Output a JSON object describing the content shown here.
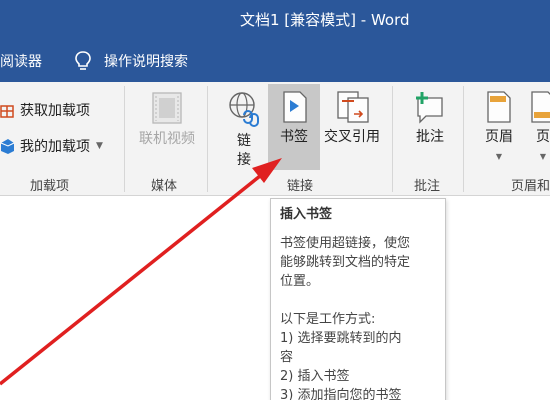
{
  "window": {
    "title": "文档1 [兼容模式]  -  Word"
  },
  "tabs": {
    "reader": "阅读器",
    "search": "操作说明搜索"
  },
  "addins": {
    "get": "获取加载项",
    "my": "我的加载项",
    "group": "加载项"
  },
  "media": {
    "online_video": "联机视频",
    "group": "媒体"
  },
  "links": {
    "link_char1": "链",
    "link_char2": "接",
    "bookmark": "书签",
    "cross_ref": "交叉引用",
    "group": "链接"
  },
  "comments": {
    "comment": "批注",
    "group": "批注"
  },
  "headerfooter": {
    "header": "页眉",
    "footer": "页",
    "group": "页眉和"
  },
  "tooltip": {
    "title": "插入书签",
    "desc1": "书签使用超链接，使您",
    "desc2": "能够跳转到文档的特定",
    "desc3": "位置。",
    "how": "以下是工作方式:",
    "step1a": "1) 选择要跳转到的内",
    "step1b": "容",
    "step2": "2) 插入书签",
    "step3": "3) 添加指向您的书签"
  },
  "colors": {
    "title_bar": "#2b579a",
    "ribbon": "#f3f3f3",
    "arrow": "#e02020"
  }
}
